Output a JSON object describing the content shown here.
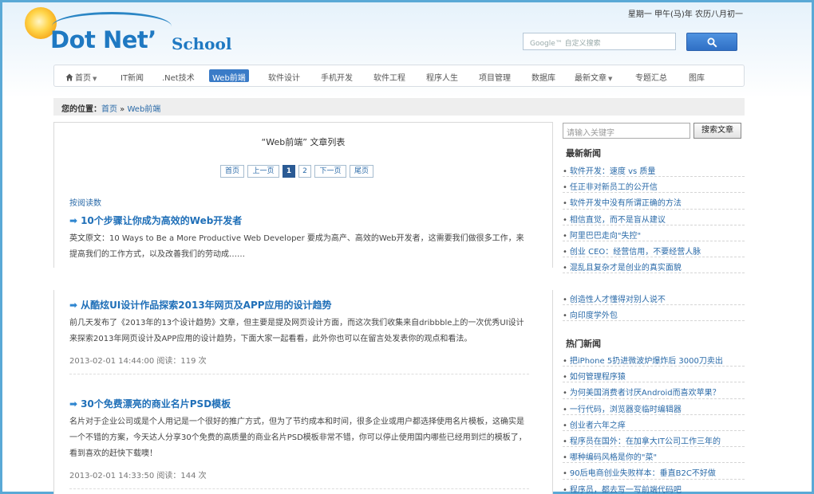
{
  "header": {
    "logo_main": "Dot Net’",
    "logo_sub": "School",
    "date_text": "星期一 甲午(马)年 农历八月初一",
    "search_placeholder": "Google™ 自定义搜索"
  },
  "nav": {
    "items": [
      {
        "label": "首页",
        "dropdown": true,
        "home": true
      },
      {
        "label": "IT新闻"
      },
      {
        "label": ".Net技术"
      },
      {
        "label": "Web前端",
        "active": true
      },
      {
        "label": "软件设计"
      },
      {
        "label": "手机开发"
      },
      {
        "label": "软件工程"
      },
      {
        "label": "程序人生"
      },
      {
        "label": "项目管理"
      },
      {
        "label": "数据库"
      },
      {
        "label": "最新文章",
        "dropdown": true
      },
      {
        "label": "专题汇总"
      },
      {
        "label": "图库"
      }
    ]
  },
  "breadcrumb": {
    "label": "您的位置：",
    "home": "首页",
    "sep": " » ",
    "current": "Web前端"
  },
  "main": {
    "list_title": "“Web前端” 文章列表",
    "pager": {
      "first": "首页",
      "prev": "上一页",
      "pages": [
        "1",
        "2"
      ],
      "current": "1",
      "next": "下一页",
      "last": "尾页"
    },
    "sort_label": "按阅读数",
    "articles": [
      {
        "title": "10个步骤让你成为高效的Web开发者",
        "summary": "英文原文：10 Ways to Be a More Productive Web Developer 要成为高产、高效的Web开发者，这需要我们做很多工作，来提高我们的工作方式，以及改善我们的劳动成……",
        "meta": ""
      },
      {
        "title": "从酷炫UI设计作品探索2013年网页及APP应用的设计趋势",
        "summary": "前几天发布了《2013年的13个设计趋势》文章，但主要是提及网页设计方面，而这次我们收集来自dribbble上的一次优秀UI设计来探索2013年网页设计及APP应用的设计趋势，下面大家一起看看，此外你也可以在留言处发表你的观点和看法。",
        "meta": "2013-02-01 14:44:00 阅读：119 次"
      },
      {
        "title": "30个免费漂亮的商业名片PSD模板",
        "summary": "名片对于企业公司或是个人用记是一个很好的推广方式，但为了节约成本和时间，很多企业或用户都选择使用名片模板，这确实是一个不错的方案，今天达人分享30个免费的高质量的商业名片PSD模板非常不错，你可以停止使用国内哪些已经用到烂的模板了，看到喜欢的赶快下载噢！",
        "meta": "2013-02-01 14:33:50 阅读：144 次"
      }
    ]
  },
  "sidebar": {
    "search_placeholder": "请输入关键字",
    "search_button": "搜索文章",
    "latest_heading": "最新新闻",
    "latest_items": [
      "软件开发：速度 vs 质量",
      "任正非对新员工的公开信",
      "软件开发中没有所谓正确的方法",
      "相信直觉，而不是盲从建议",
      "阿里巴巴走向\"失控\"",
      "创业 CEO：经营信用，不要经营人脉",
      "混乱且复杂才是创业的真实面貌"
    ],
    "latest_items_2": [
      "创造性人才懂得对别人说不",
      "向印度学外包"
    ],
    "hot_heading": "热门新闻",
    "hot_items": [
      "把iPhone 5扔进微波炉爆炸后 3000刀卖出",
      "如何管理程序猿",
      "为何美国消费者讨厌Android而喜欢苹果？",
      "一行代码，浏览器变临时编辑器",
      "创业者六年之痒",
      "程序员在国外：在加拿大IT公司工作三年的",
      "哪种编码风格是你的\"菜\"",
      "90后电商创业失败样本：垂直B2C不好做",
      "程序员，都去写一写前端代码吧"
    ]
  },
  "colors": {
    "accent": "#3a7bc7",
    "link": "#2a6aa8",
    "frame": "#5aa9d6"
  }
}
